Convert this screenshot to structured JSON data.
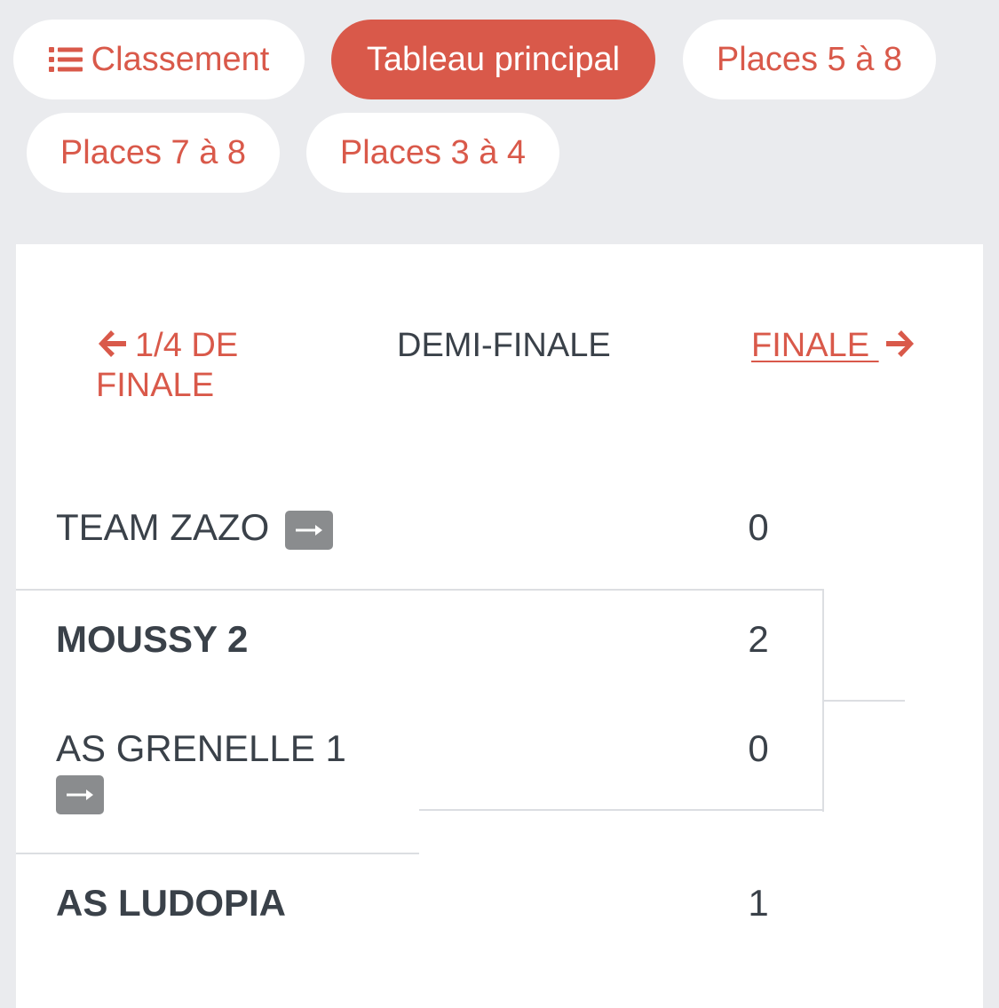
{
  "tabs": [
    {
      "label": "Classement",
      "icon": "list-icon",
      "active": false
    },
    {
      "label": "Tableau principal",
      "active": true
    },
    {
      "label": "Places 5 à 8",
      "active": false
    },
    {
      "label": "Places 7 à 8",
      "active": false
    },
    {
      "label": "Places 3 à 4",
      "active": false
    }
  ],
  "round_nav": {
    "prev_label": "1/4 DE FINALE",
    "current_label": "DEMI-FINALE",
    "next_label": "FINALE "
  },
  "matches": [
    {
      "team1": {
        "name": "TEAM ZAZO",
        "score": "0",
        "winner": false,
        "has_link": true
      },
      "team2": {
        "name": "MOUSSY 2",
        "score": "2",
        "winner": true
      }
    },
    {
      "team1": {
        "name": "AS GRENELLE 1",
        "score": "0",
        "winner": false,
        "has_link": true
      },
      "team2": {
        "name": "AS LUDOPIA",
        "score": "1",
        "winner": true
      }
    }
  ],
  "colors": {
    "accent": "#d9594a",
    "background": "#eaebee",
    "text": "#3a4149",
    "badge": "#8a8c8e",
    "line": "#dcdee2"
  }
}
